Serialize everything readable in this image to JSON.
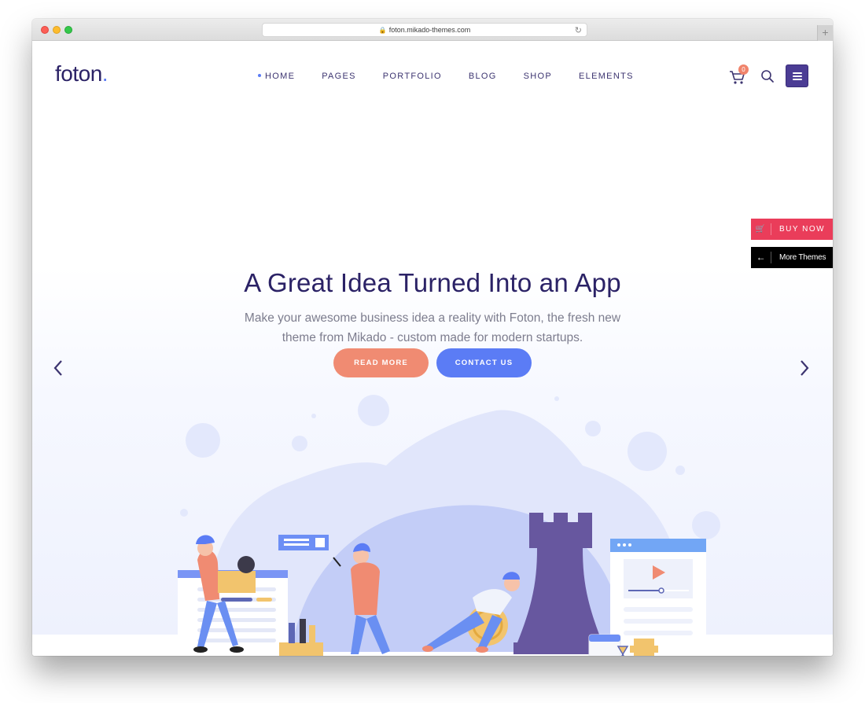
{
  "browser": {
    "url": "foton.mikado-themes.com",
    "lock_icon": "lock-icon",
    "reload_icon": "reload-icon",
    "new_tab_label": "+"
  },
  "header": {
    "logo": "foton",
    "logo_dot": ".",
    "nav": [
      {
        "label": "HOME",
        "active": true
      },
      {
        "label": "PAGES",
        "active": false
      },
      {
        "label": "PORTFOLIO",
        "active": false
      },
      {
        "label": "BLOG",
        "active": false
      },
      {
        "label": "SHOP",
        "active": false
      },
      {
        "label": "ELEMENTS",
        "active": false
      }
    ],
    "cart_count": "0",
    "icons": [
      "cart-icon",
      "search-icon",
      "menu-icon"
    ]
  },
  "side_widgets": {
    "buy_now": "BUY NOW",
    "more_themes": "More Themes"
  },
  "hero": {
    "title": "A Great Idea Turned Into an App",
    "subtitle_line1": "Make your awesome business idea a reality with Foton, the fresh new",
    "subtitle_line2": "theme from Mikado - custom made for modern startups.",
    "primary_button": "READ MORE",
    "secondary_button": "CONTACT US",
    "prev_arrow": "‹",
    "next_arrow": "›"
  },
  "colors": {
    "brand_dark": "#2b2266",
    "accent_blue": "#5b7cf5",
    "accent_coral": "#f08b72",
    "buy_now_red": "#ea3d5a",
    "menu_purple": "#4b3c94",
    "rook_purple": "#67579f"
  }
}
